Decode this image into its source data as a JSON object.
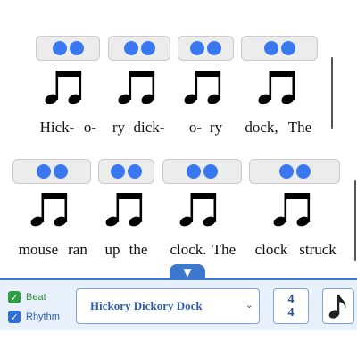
{
  "row1": {
    "lyrics": [
      "Hick-",
      "o-",
      "ry",
      "dick-",
      "o-",
      "ry",
      "dock,",
      "The"
    ]
  },
  "row2": {
    "lyrics": [
      "mouse",
      "ran",
      "up",
      "the",
      "clock.",
      "The",
      "clock",
      "struck"
    ]
  },
  "toggle": {
    "icon": "▼"
  },
  "controls": {
    "beat_label": "Beat",
    "rhythm_label": "Rhythm",
    "beat_checked": true,
    "rhythm_checked": true,
    "song_title": "Hickory Dickory Dock",
    "time_sig_top": "4",
    "time_sig_bottom": "4"
  },
  "colors": {
    "accent": "#3c78cf",
    "beat_dot": "#3a78f2",
    "beat_check": "#2f9e44",
    "rhythm_check": "#2f6fd6"
  },
  "icons": {
    "beat_dots": "two-dot-beat-icon",
    "note": "eighth-note-icon",
    "chevron": "chevron-down-icon"
  }
}
